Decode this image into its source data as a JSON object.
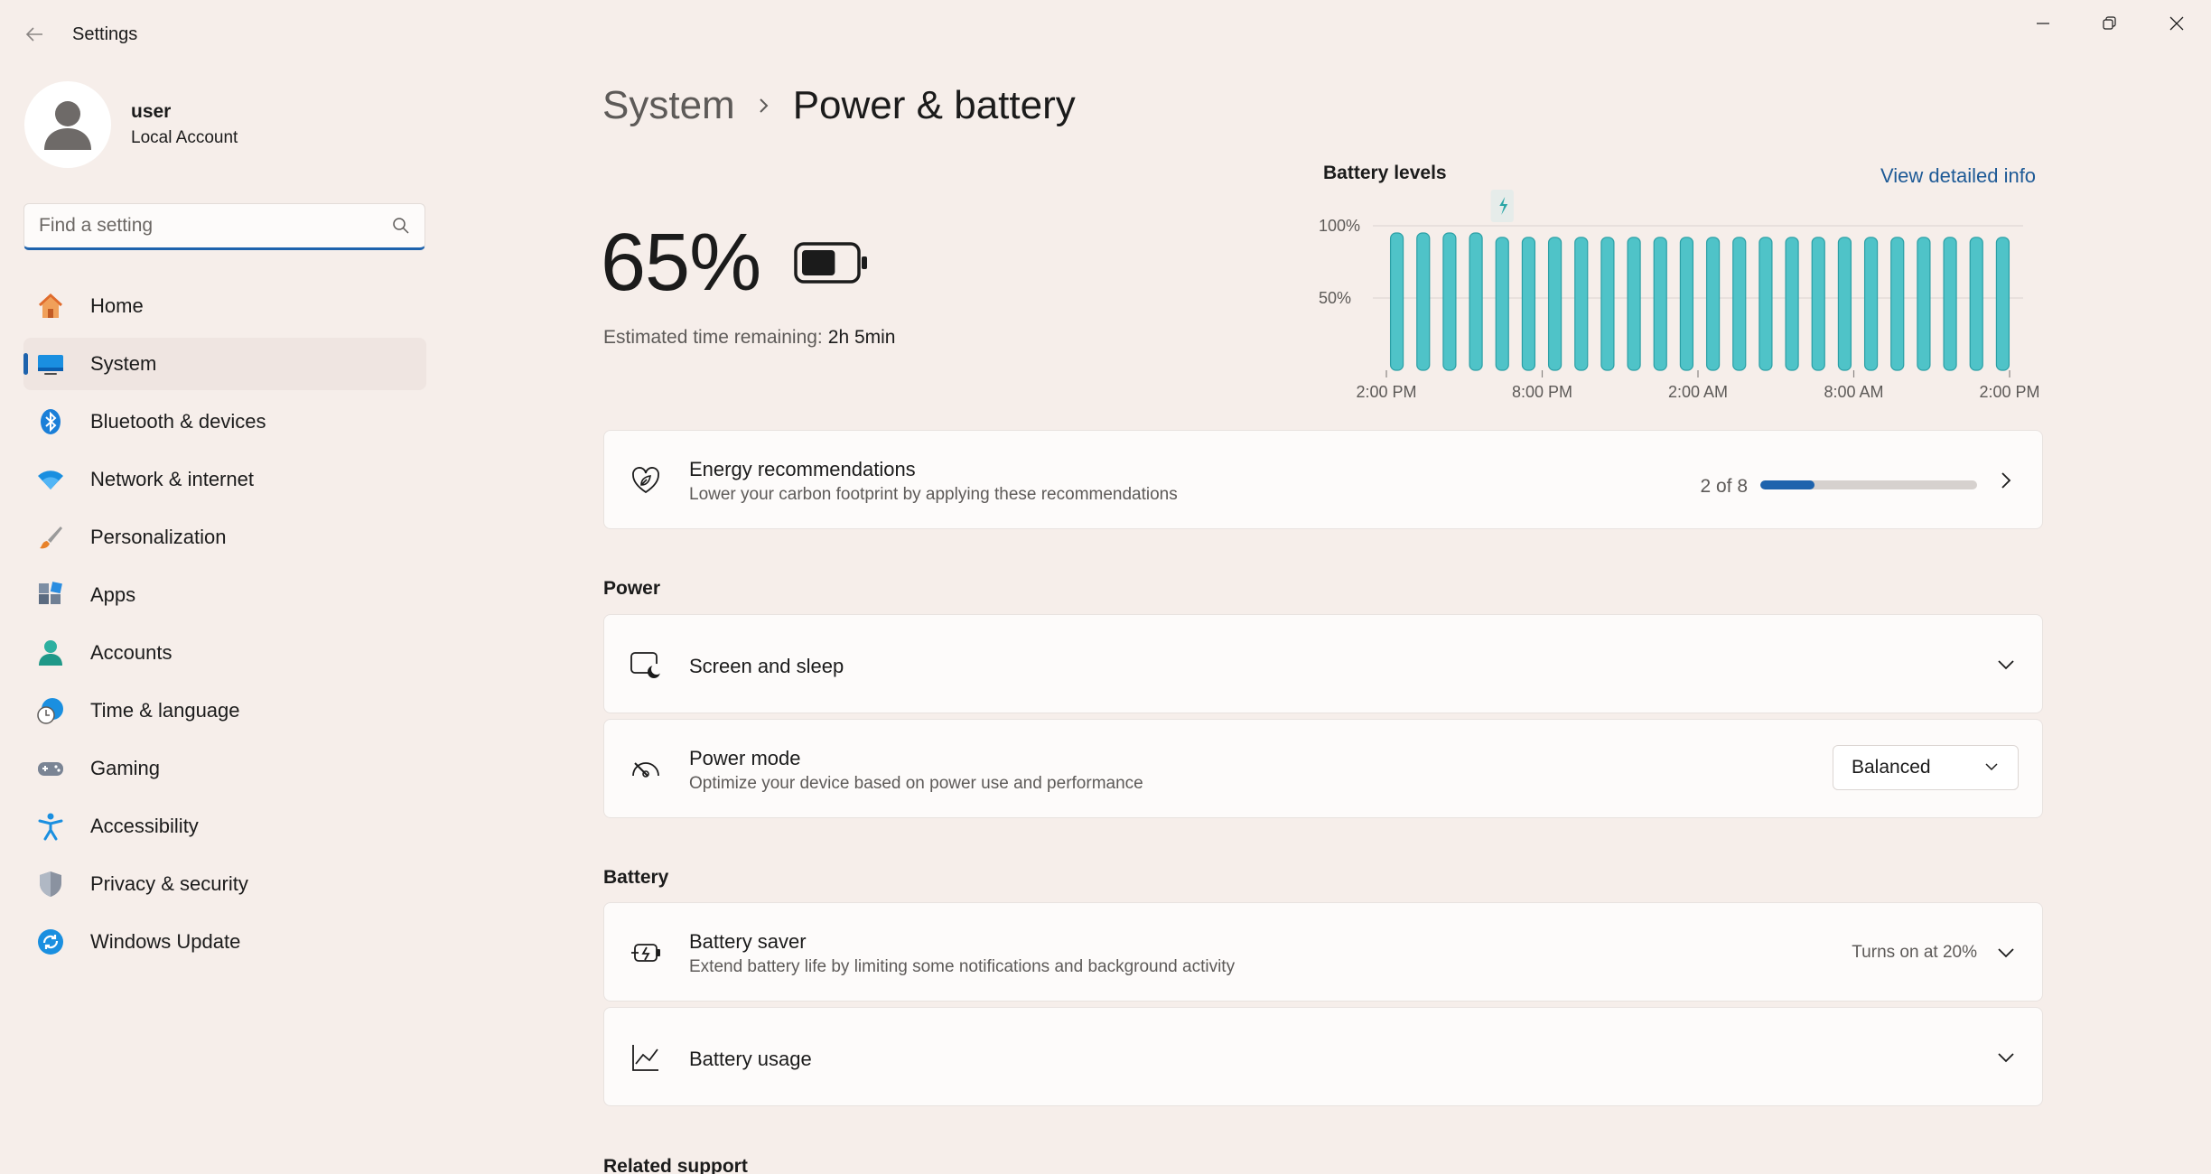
{
  "window": {
    "title": "Settings"
  },
  "profile": {
    "name": "user",
    "account_type": "Local Account"
  },
  "search": {
    "placeholder": "Find a setting"
  },
  "sidebar": {
    "items": [
      {
        "label": "Home",
        "icon": "home-icon"
      },
      {
        "label": "System",
        "icon": "system-icon",
        "active": true
      },
      {
        "label": "Bluetooth & devices",
        "icon": "bluetooth-icon"
      },
      {
        "label": "Network & internet",
        "icon": "wifi-icon"
      },
      {
        "label": "Personalization",
        "icon": "brush-icon"
      },
      {
        "label": "Apps",
        "icon": "apps-icon"
      },
      {
        "label": "Accounts",
        "icon": "accounts-icon"
      },
      {
        "label": "Time & language",
        "icon": "clock-globe-icon"
      },
      {
        "label": "Gaming",
        "icon": "gamepad-icon"
      },
      {
        "label": "Accessibility",
        "icon": "accessibility-icon"
      },
      {
        "label": "Privacy & security",
        "icon": "shield-icon"
      },
      {
        "label": "Windows Update",
        "icon": "update-icon"
      }
    ]
  },
  "breadcrumb": {
    "parent": "System",
    "current": "Power & battery"
  },
  "battery": {
    "percent": "65%",
    "level": 0.65,
    "estimate_label": "Estimated time remaining:",
    "estimate_value": "2h 5min"
  },
  "battery_chart": {
    "title": "Battery levels",
    "link": "View detailed info",
    "chart_data": {
      "type": "bar",
      "title": "Battery levels",
      "y_ticks": [
        "100%",
        "50%"
      ],
      "x_ticks": [
        "2:00 PM",
        "8:00 PM",
        "2:00 AM",
        "8:00 AM",
        "2:00 PM"
      ],
      "ylim": [
        0,
        100
      ],
      "values": [
        95,
        95,
        95,
        95,
        92,
        92,
        92,
        92,
        92,
        92,
        92,
        92,
        92,
        92,
        92,
        92,
        92,
        92,
        92,
        92,
        92,
        92,
        92,
        92
      ],
      "charging_marker_index": 4,
      "color": "#4fc3c8"
    }
  },
  "energy": {
    "title": "Energy recommendations",
    "subtitle": "Lower your carbon footprint by applying these recommendations",
    "progress_text": "2 of 8",
    "progress": 0.25
  },
  "sections": {
    "power": "Power",
    "battery": "Battery",
    "related": "Related support"
  },
  "screen_sleep": {
    "title": "Screen and sleep"
  },
  "power_mode": {
    "title": "Power mode",
    "subtitle": "Optimize your device based on power use and performance",
    "value": "Balanced"
  },
  "battery_saver": {
    "title": "Battery saver",
    "subtitle": "Extend battery life by limiting some notifications and background activity",
    "status": "Turns on at 20%"
  },
  "battery_usage": {
    "title": "Battery usage"
  },
  "colors": {
    "accent": "#1e63ad",
    "link": "#1e5a96",
    "chart_bar": "#4fc3c8",
    "background": "#f6eeea"
  }
}
